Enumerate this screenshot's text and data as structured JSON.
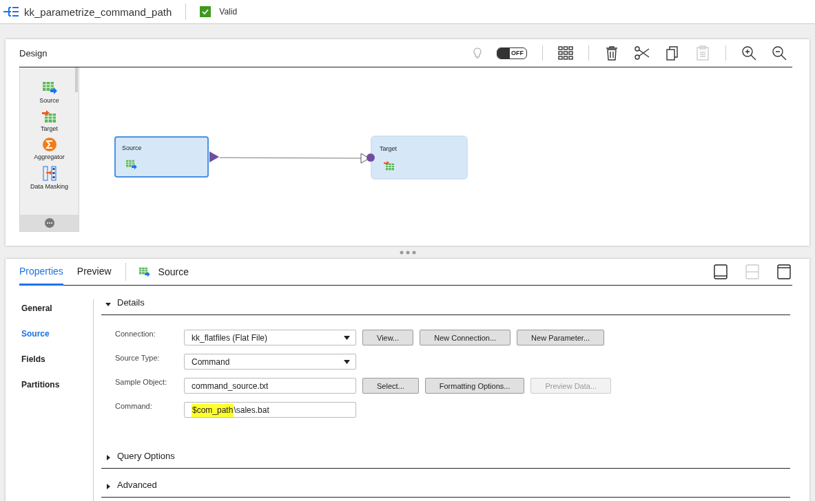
{
  "header": {
    "title": "kk_parametrize_command_path",
    "status": "Valid",
    "valid": true
  },
  "design": {
    "title": "Design",
    "recommendations": {
      "on": false,
      "label": "OFF"
    },
    "toolbar": [
      {
        "kind": "grid",
        "disabled": false
      },
      {
        "kind": "delete",
        "disabled": false
      },
      {
        "kind": "cut",
        "disabled": false
      },
      {
        "kind": "copy",
        "disabled": false
      },
      {
        "kind": "paste",
        "disabled": true
      },
      {
        "kind": "zoom-in",
        "disabled": false
      },
      {
        "kind": "zoom-out",
        "disabled": false
      }
    ],
    "palette": [
      {
        "label": "Source",
        "kind": "source"
      },
      {
        "label": "Target",
        "kind": "target"
      },
      {
        "label": "Aggregator",
        "kind": "aggregator"
      },
      {
        "label": "Data Masking",
        "kind": "masking"
      }
    ],
    "nodes": [
      {
        "label": "Source",
        "kind": "source",
        "selected": true
      },
      {
        "label": "Target",
        "kind": "target",
        "selected": false
      }
    ]
  },
  "properties": {
    "tabs": [
      {
        "label": "Properties",
        "selected": true
      },
      {
        "label": "Preview",
        "selected": false
      }
    ],
    "object": "Source",
    "layouts": [
      {
        "kind": "bottom",
        "disabled": false
      },
      {
        "kind": "split",
        "disabled": true
      },
      {
        "kind": "top",
        "disabled": false
      }
    ],
    "nav": [
      {
        "label": "General",
        "selected": false
      },
      {
        "label": "Source",
        "selected": true
      },
      {
        "label": "Fields",
        "selected": false
      },
      {
        "label": "Partitions",
        "selected": false
      }
    ],
    "sections": [
      {
        "title": "Details",
        "expanded": true
      },
      {
        "title": "Query Options",
        "expanded": false
      },
      {
        "title": "Advanced",
        "expanded": false
      }
    ],
    "fields": [
      {
        "label": "Connection:",
        "kind": "select",
        "value": "kk_flatfiles (Flat File)",
        "buttons": [
          {
            "label": "View...",
            "disabled": false
          },
          {
            "label": "New Connection...",
            "disabled": false
          },
          {
            "label": "New Parameter...",
            "disabled": false
          }
        ]
      },
      {
        "label": "Source Type:",
        "kind": "select",
        "value": "Command"
      },
      {
        "label": "Sample Object:",
        "kind": "text",
        "value": "command_source.txt",
        "buttons": [
          {
            "label": "Select...",
            "disabled": false
          },
          {
            "label": "Formatting Options...",
            "disabled": false
          },
          {
            "label": "Preview Data...",
            "disabled": true
          }
        ]
      },
      {
        "label": "Command:",
        "kind": "text",
        "highlight": "$com_path",
        "value": "\\sales.bat"
      }
    ]
  }
}
